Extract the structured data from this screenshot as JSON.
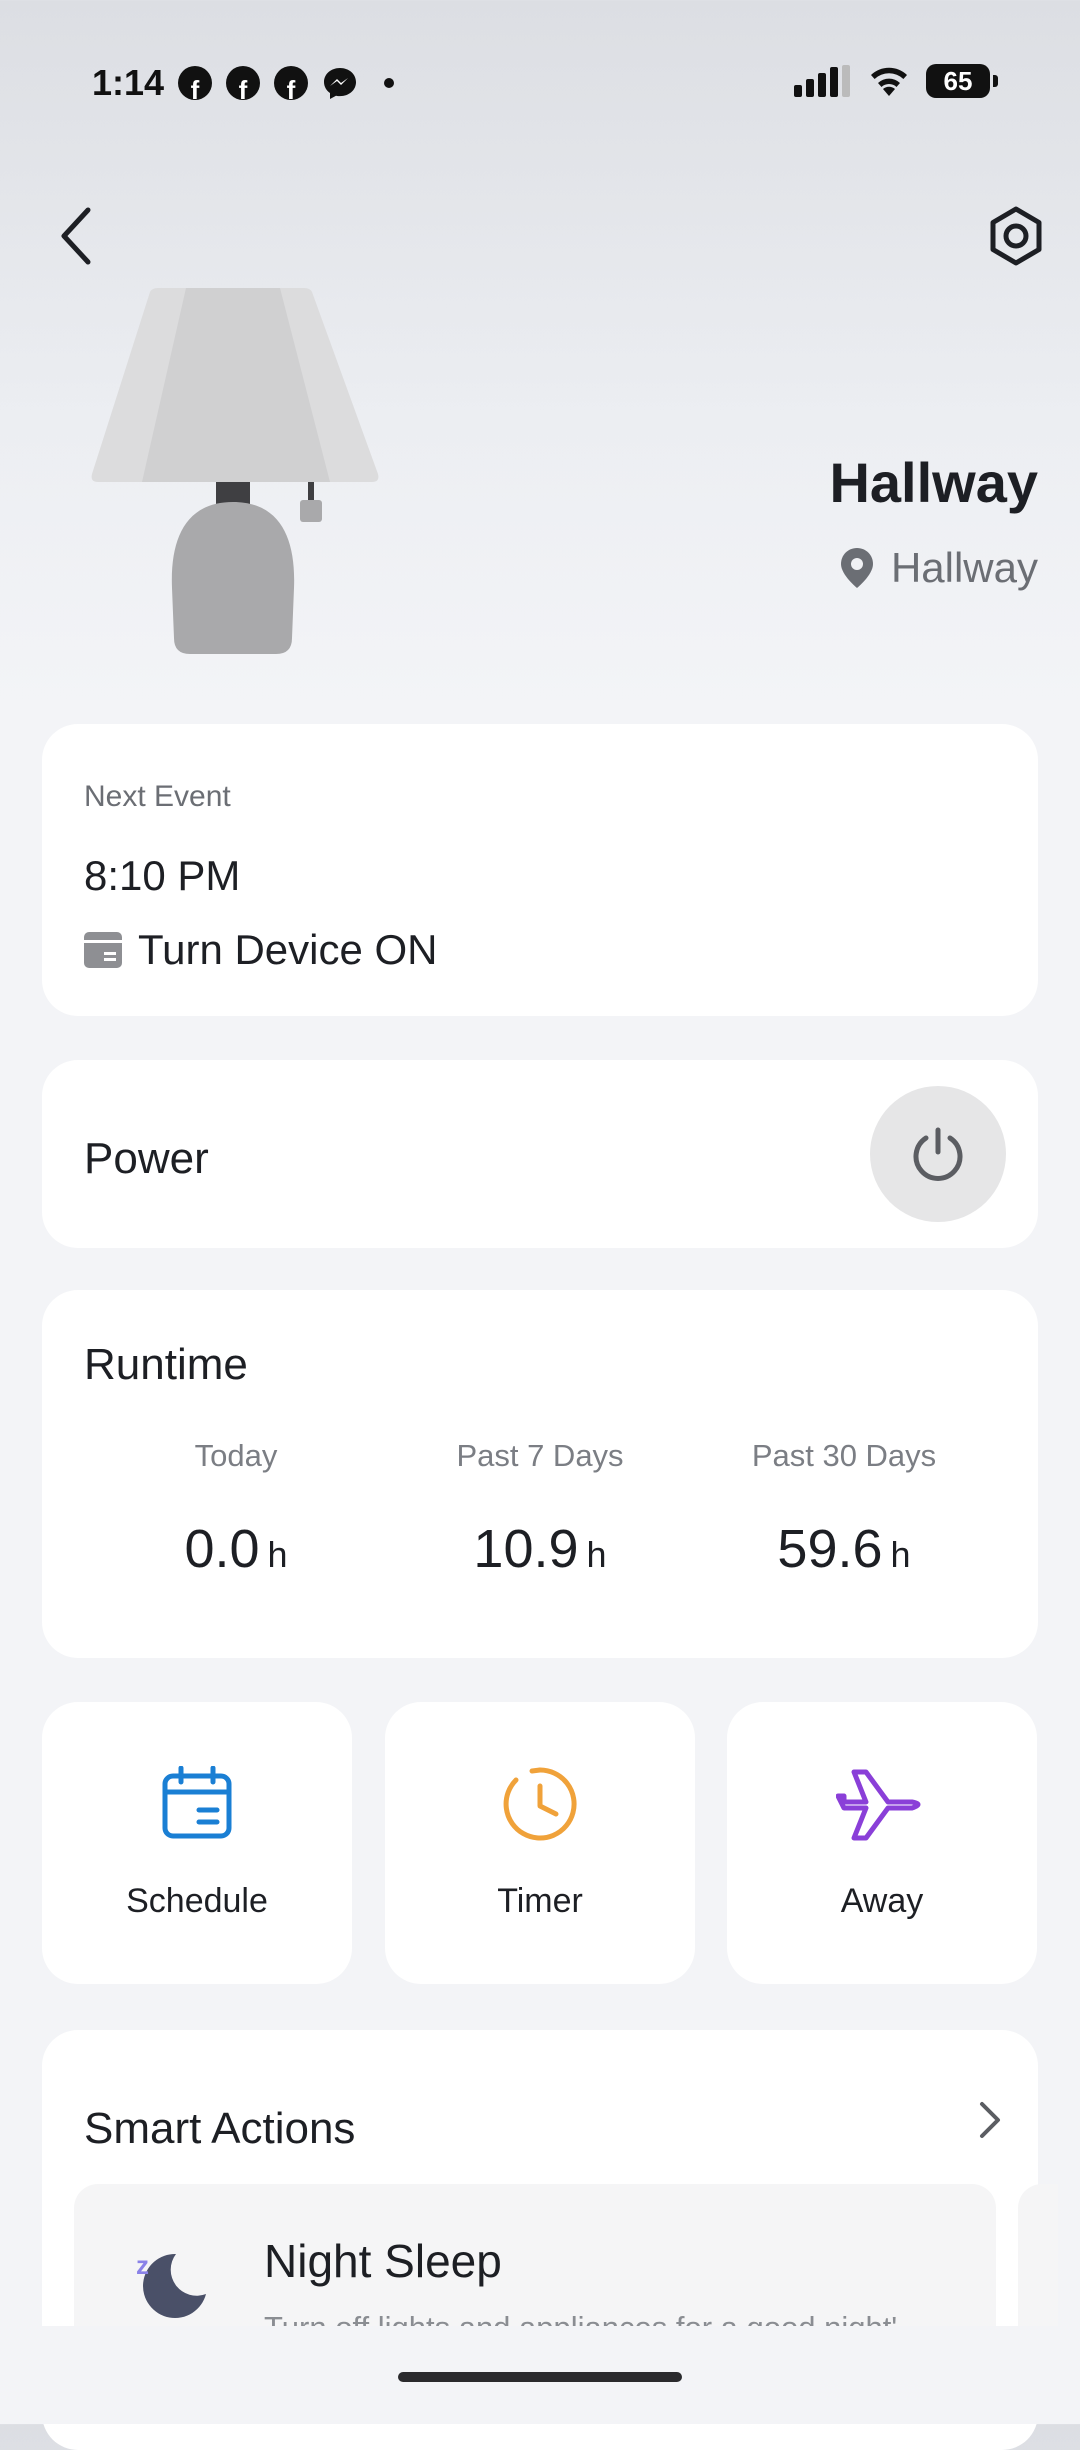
{
  "status_bar": {
    "time": "1:14",
    "notif_icons": [
      "facebook-icon",
      "facebook-icon",
      "facebook-icon",
      "messenger-icon"
    ],
    "battery": "65"
  },
  "header": {
    "device_name": "Hallway",
    "location": "Hallway"
  },
  "next_event": {
    "label": "Next Event",
    "time": "8:10 PM",
    "action": "Turn Device ON"
  },
  "power": {
    "label": "Power",
    "state": "off"
  },
  "runtime": {
    "title": "Runtime",
    "stats": [
      {
        "label": "Today",
        "value": "0.0",
        "unit": "h"
      },
      {
        "label": "Past 7 Days",
        "value": "10.9",
        "unit": "h"
      },
      {
        "label": "Past 30 Days",
        "value": "59.6",
        "unit": "h"
      }
    ]
  },
  "quick_actions": [
    {
      "label": "Schedule",
      "icon": "calendar-icon",
      "color": "#1a7fd4"
    },
    {
      "label": "Timer",
      "icon": "clock-icon",
      "color": "#f0a23a"
    },
    {
      "label": "Away",
      "icon": "airplane-icon",
      "color": "#8a3fd8"
    }
  ],
  "smart_actions": {
    "title": "Smart Actions",
    "items": [
      {
        "name": "Night Sleep",
        "description": "Turn off lights and appliances for a good night'...",
        "icon": "moon-icon"
      }
    ]
  },
  "colors": {
    "card_bg": "#ffffff",
    "page_bg": "#f3f4f7",
    "primary_text": "#1d1f24",
    "secondary_text": "#6b6e74"
  }
}
